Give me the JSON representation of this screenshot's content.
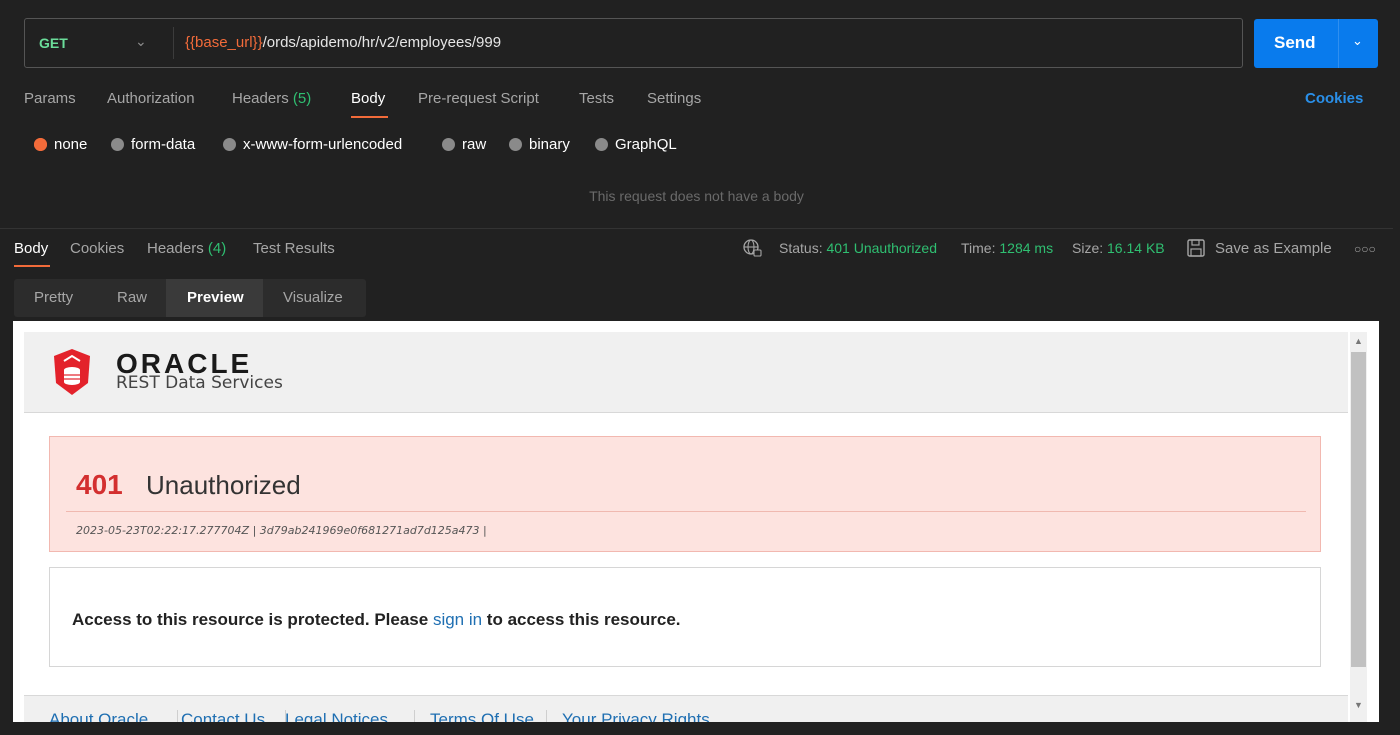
{
  "request": {
    "method": "GET",
    "url_var": "{{base_url}}",
    "url_path": "/ords/apidemo/hr/v2/employees/999",
    "send_label": "Send"
  },
  "request_tabs": {
    "params": "Params",
    "authorization": "Authorization",
    "headers": "Headers",
    "headers_count": "(5)",
    "body": "Body",
    "prerequest": "Pre-request Script",
    "tests": "Tests",
    "settings": "Settings",
    "cookies": "Cookies"
  },
  "body_types": [
    "none",
    "form-data",
    "x-www-form-urlencoded",
    "raw",
    "binary",
    "GraphQL"
  ],
  "selected_body_type": "none",
  "no_body_text": "This request does not have a body",
  "response_tabs": {
    "body": "Body",
    "cookies": "Cookies",
    "headers": "Headers",
    "headers_count": "(4)",
    "test_results": "Test Results"
  },
  "response_meta": {
    "status_label": "Status:",
    "status_value": "401 Unauthorized",
    "time_label": "Time:",
    "time_value": "1284 ms",
    "size_label": "Size:",
    "size_value": "16.14 KB",
    "save_example": "Save as Example"
  },
  "view_modes": [
    "Pretty",
    "Raw",
    "Preview",
    "Visualize"
  ],
  "selected_view_mode": "Preview",
  "preview": {
    "brand": "ORACLE",
    "product": "REST Data Services",
    "error_code": "401",
    "error_text": "Unauthorized",
    "error_meta": "2023-05-23T02:22:17.277704Z | 3d79ab241969e0f681271ad7d125a473 |",
    "message_before": "Access to this resource is protected. Please ",
    "message_link": "sign in",
    "message_after": " to access this resource.",
    "footer_links": [
      "About Oracle",
      "Contact Us",
      "Legal Notices",
      "Terms Of Use",
      "Your Privacy Rights"
    ]
  },
  "colors": {
    "accent": "#f26b3a",
    "send": "#097bed",
    "status_ok": "#2fbf71",
    "error": "#d32f2f"
  }
}
